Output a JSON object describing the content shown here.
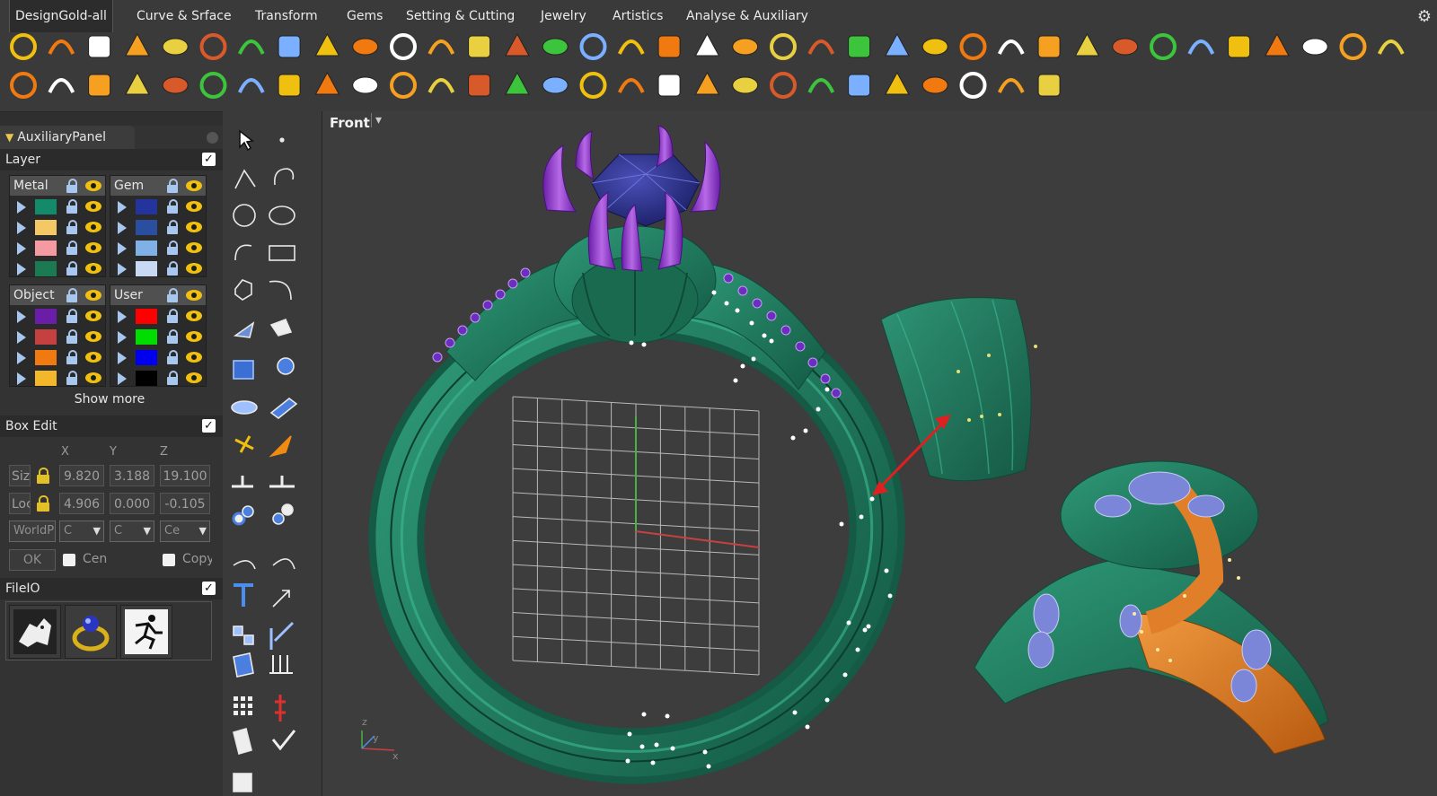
{
  "menu": {
    "items": [
      "DesignGold-all",
      "Curve & Srface",
      "Transform",
      "Gems",
      "Setting & Cutting",
      "Jewelry",
      "Artistics",
      "Analyse & Auxiliary"
    ],
    "settings_icon": "gear-icon"
  },
  "toolbar": {
    "row1_icons": [
      "circle-curve-icon",
      "arc-curve-icon",
      "u-curve-icon",
      "c-curve-icon",
      "s-curve-icon",
      "ring-profile-icon",
      "star-curve-icon",
      "cross-curve-icon",
      "spiral-icon",
      "horseshoe-icon",
      "leaf-icon",
      "leaf2-icon",
      "feather-icon",
      "wand-icon",
      "sparkle-icon",
      "vase-icon",
      "cup-icon",
      "bell-icon",
      "drop-icon",
      "box-icon",
      "mirror-icon",
      "split-icon",
      "cross-align-icon",
      "grid-array-icon",
      "envelope-icon",
      "gem-set-icon",
      "pearl-icon",
      "bridge-icon",
      "bridge2-icon",
      "prong-icon",
      "cube-wire-icon",
      "gem-green-icon",
      "oval-gem-icon",
      "pave-icon",
      "bead-chain-icon",
      "bead-chain2-icon",
      "bead-ring-icon"
    ],
    "row2_icons": [
      "bead-pair-icon",
      "layer-stack-icon",
      "sun-icon",
      "ring-gems-icon",
      "dots-grid-icon",
      "bead-line-icon",
      "bucket-icon",
      "rail-icon",
      "stick-icon",
      "flower-icon",
      "ring-head-icon",
      "tail-icon",
      "swirl-icon",
      "chain-icon",
      "dots-cluster-icon",
      "hatch-icon",
      "rose-icon",
      "eye-curve-icon",
      "scales-icon",
      "palette-icon",
      "figure-plant-icon",
      "fold-icon",
      "h-badge-icon",
      "file-icon",
      "list-icon",
      "ring-setting-icon",
      "runner-icon",
      "people-icon"
    ]
  },
  "aux_panel": {
    "tab_label": "AuxiliaryPanel",
    "layer": {
      "title": "Layer",
      "groups": [
        {
          "name": "Metal",
          "swatches": [
            "#138a6a",
            "#f5c866",
            "#f59aa0",
            "#1c7a52"
          ]
        },
        {
          "name": "Gem",
          "swatches": [
            "#23359c",
            "#2a4fa0",
            "#7fb0e6",
            "#c7d9f3"
          ]
        },
        {
          "name": "Object",
          "swatches": [
            "#6a1ea8",
            "#c54040",
            "#f07a10",
            "#f2b72a"
          ]
        },
        {
          "name": "User",
          "swatches": [
            "#ff0000",
            "#00dd00",
            "#0000ee",
            "#000000"
          ]
        }
      ],
      "show_more": "Show more"
    },
    "box_edit": {
      "title": "Box Edit",
      "axis_labels": [
        "X",
        "Y",
        "Z"
      ],
      "size_label": "Size",
      "size_values": [
        "9.820",
        "3.188",
        "19.100"
      ],
      "loc_label": "Loc",
      "loc_values": [
        "4.906",
        "0.000",
        "-0.105"
      ],
      "world_label": "WorldP",
      "selects": [
        "C",
        "C",
        "Ce"
      ],
      "ok_label": "OK",
      "center_label": "Cen",
      "copy_label": "Copy"
    },
    "file_io": {
      "title": "FileIO",
      "buttons": [
        "rhino-icon",
        "ring-file-icon",
        "runner-file-icon"
      ]
    }
  },
  "viewport": {
    "view_name": "Front",
    "axis_z": "z",
    "axis_y": "y",
    "axis_x": "x"
  },
  "colors": {
    "metal_green": "#1f7a5f",
    "gem_blue": "#2a2f8a",
    "prong_purple": "#8a2fc4",
    "highlight_orange": "#e07e2a",
    "arrow_red": "#e02020",
    "accent_yellow": "#f0c010"
  }
}
